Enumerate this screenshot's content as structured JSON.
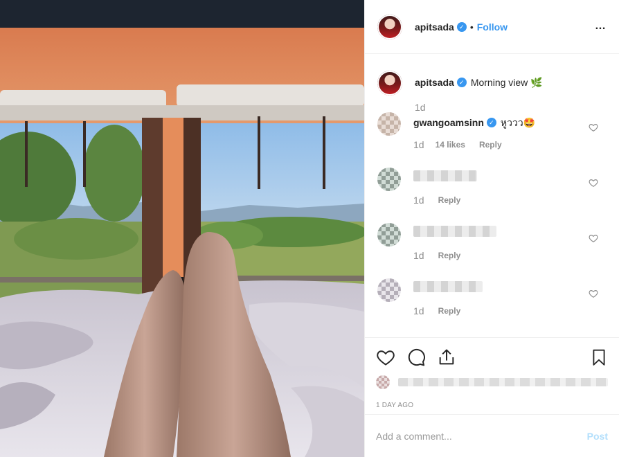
{
  "header": {
    "username": "apitsada",
    "dot": "•",
    "follow_label": "Follow",
    "more_icon": "…"
  },
  "caption": {
    "username": "apitsada",
    "text": "Morning view 🌿",
    "time": "1d"
  },
  "comments": [
    {
      "username": "gwangoamsinn",
      "text": "หูววว🤩",
      "time": "1d",
      "likes": "14 likes",
      "reply": "Reply",
      "verified": true
    },
    {
      "username": "",
      "text": "",
      "time": "1d",
      "reply": "Reply",
      "blurred": true
    },
    {
      "username": "",
      "text": "",
      "time": "1d",
      "reply": "Reply",
      "blurred": true
    },
    {
      "username": "",
      "text": "",
      "time": "1d",
      "reply": "Reply",
      "blurred": true
    }
  ],
  "post_date": "1 DAY AGO",
  "add_comment": {
    "placeholder": "Add a comment...",
    "post_label": "Post"
  },
  "colors": {
    "accent": "#3897f0",
    "post_disabled": "#b2dffc",
    "muted": "#8e8e8e"
  },
  "icons": [
    "heart-icon",
    "comment-icon",
    "share-icon",
    "bookmark-icon",
    "verified-icon",
    "more-options-icon"
  ]
}
